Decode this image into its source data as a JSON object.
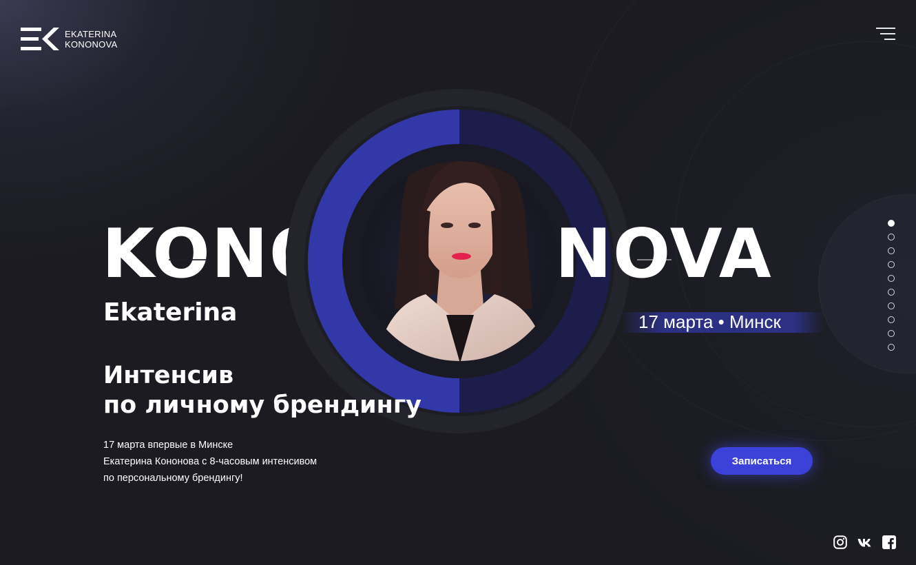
{
  "header": {
    "logo_line1": "EKATERINA",
    "logo_line2": "KONONOVA"
  },
  "hero": {
    "title_left": "KONO",
    "title_right": "NOVA",
    "first_name": "Ekaterina",
    "event_date": "17 марта • Минск",
    "headline_line1": "Интенсив",
    "headline_line2": "по личному брендингу",
    "description_line1": "17 марта впервые в Минске",
    "description_line2": "Екатерина Кононова с 8-часовым интенсивом",
    "description_line3": "по персональному брендингу!",
    "cta_label": "Записаться"
  },
  "colors": {
    "background": "#1b1b21",
    "accent": "#3c41d9",
    "ring_blue": "#2e3399",
    "ring_dark": "#23232d"
  },
  "icons": {
    "menu": "hamburger-menu-icon",
    "instagram": "instagram-icon",
    "vk": "vk-icon",
    "facebook": "facebook-icon"
  },
  "slider": {
    "total": 10,
    "active_index": 0
  }
}
